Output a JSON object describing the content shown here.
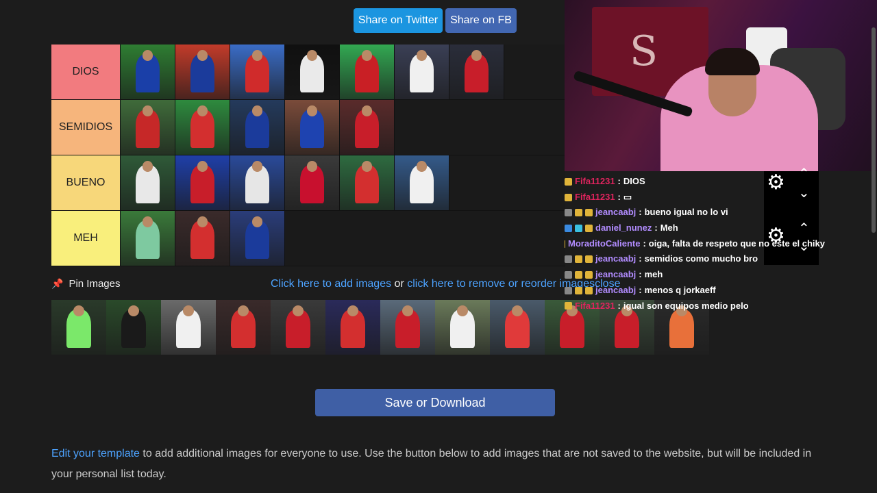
{
  "share": {
    "twitter": "Share on Twitter",
    "facebook": "Share on FB"
  },
  "tiers": [
    {
      "label": "DIOS",
      "color": "#f27b7f",
      "images": [
        [
          "#2e7d32",
          "#1a3fa8"
        ],
        [
          "#c23b2a",
          "#1b3b9b"
        ],
        [
          "#3a6cc6",
          "#d02b2b"
        ],
        [
          "#101010",
          "#eaeaea"
        ],
        [
          "#32a852",
          "#c91f25"
        ],
        [
          "#3a3f55",
          "#f0f0f0"
        ],
        [
          "#2a2d3a",
          "#c81e2a"
        ]
      ]
    },
    {
      "label": "SEMIDIOS",
      "color": "#f6b57c",
      "images": [
        [
          "#3f6b3a",
          "#c62828"
        ],
        [
          "#2e8b3e",
          "#d32f2f"
        ],
        [
          "#243a5c",
          "#1b3b9b"
        ],
        [
          "#7a4b3a",
          "#1e43b0"
        ],
        [
          "#5a2b2b",
          "#c81e2a"
        ]
      ]
    },
    {
      "label": "BUENO",
      "color": "#f7d77a",
      "images": [
        [
          "#2f5a38",
          "#e8e8e8"
        ],
        [
          "#1f3fa8",
          "#c81e2a"
        ],
        [
          "#2a4a9a",
          "#e6e6e6"
        ],
        [
          "#3a3a3a",
          "#c8102e"
        ],
        [
          "#2e6b40",
          "#d32f2f"
        ],
        [
          "#345a8a",
          "#f0f0f0"
        ]
      ]
    },
    {
      "label": "MEH",
      "color": "#f9ef7c",
      "images": [
        [
          "#3a7a3a",
          "#7ec9a0"
        ],
        [
          "#3a2a2a",
          "#d32f2f"
        ],
        [
          "#2a3d7a",
          "#1b3b9b"
        ]
      ]
    }
  ],
  "pin": {
    "label": "Pin Images",
    "links_prefix": "Click here to add images",
    "links_or": " or ",
    "links_remove": "click here to remove or reorder images",
    "close": "close"
  },
  "pool": [
    [
      "#2a3a2a",
      "#7be86a"
    ],
    [
      "#2a4a2a",
      "#1a1a1a"
    ],
    [
      "#6a6a6a",
      "#f0f0f0"
    ],
    [
      "#3a2a2a",
      "#d32f2f"
    ],
    [
      "#3a3a3a",
      "#c81e2a"
    ],
    [
      "#2a2a5a",
      "#d32f2f"
    ],
    [
      "#5a6a7a",
      "#c81e2a"
    ],
    [
      "#6a7a5a",
      "#f0f0f0"
    ],
    [
      "#4a5a6a",
      "#e03a3a"
    ],
    [
      "#3a5a3a",
      "#c81e2a"
    ],
    [
      "#3a4a3a",
      "#c81e2a"
    ],
    [
      "#2a2a2a",
      "#e8703a"
    ]
  ],
  "save_label": "Save or Download",
  "footer": {
    "link": "Edit your template",
    "text": " to add additional images for everyone to use. Use the button below to add images that are not saved to the website, but will be included in your personal list today."
  },
  "webcam": {
    "flag_letter": "S"
  },
  "chat": [
    {
      "badges": [
        "#e0b43a"
      ],
      "user": "Fifa11231",
      "user_color": "#e0245e",
      "message": "DIOS"
    },
    {
      "badges": [
        "#e0b43a"
      ],
      "user": "Fifa11231",
      "user_color": "#e0245e",
      "message": "▭"
    },
    {
      "badges": [
        "#888888",
        "#e0b43a",
        "#e0b43a"
      ],
      "user": "jeancaabj",
      "user_color": "#b28cff",
      "message": "bueno igual no lo vi"
    },
    {
      "badges": [
        "#3a8ae0",
        "#3ac0e0",
        "#e0b43a"
      ],
      "user": "daniel_nunez",
      "user_color": "#b28cff",
      "message": "Meh"
    },
    {
      "badges": [
        "#e0b43a"
      ],
      "user": "MoraditoCaliente",
      "user_color": "#b28cff",
      "message": "oiga, falta de respeto que no este el chiky"
    },
    {
      "badges": [
        "#888888",
        "#e0b43a",
        "#e0b43a"
      ],
      "user": "jeancaabj",
      "user_color": "#b28cff",
      "message": "semidios como mucho bro"
    },
    {
      "badges": [
        "#888888",
        "#e0b43a",
        "#e0b43a"
      ],
      "user": "jeancaabj",
      "user_color": "#b28cff",
      "message": "meh"
    },
    {
      "badges": [
        "#888888",
        "#e0b43a",
        "#e0b43a"
      ],
      "user": "jeancaabj",
      "user_color": "#b28cff",
      "message": "menos q jorkaeff"
    },
    {
      "badges": [
        "#e0b43a"
      ],
      "user": "Fifa11231",
      "user_color": "#e0245e",
      "message": "igual son equipos medio pelo"
    }
  ],
  "icons": {
    "gear": "gear-icon",
    "chevron_up": "chevron-up-icon",
    "chevron_down": "chevron-down-icon",
    "pin": "pin-icon"
  }
}
